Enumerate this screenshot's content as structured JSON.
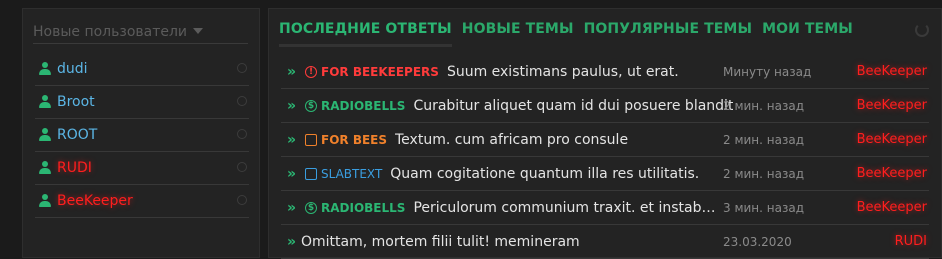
{
  "sidebar": {
    "select_label": "Новые пользователи",
    "users": [
      {
        "name": "dudi",
        "color": "#5bb6e6"
      },
      {
        "name": "Broot",
        "color": "#5bb6e6"
      },
      {
        "name": "ROOT",
        "color": "#5bb6e6"
      },
      {
        "name": "RUDI",
        "color": "#ff1e1e"
      },
      {
        "name": "BeeKeeper",
        "color": "#ff1e1e"
      }
    ]
  },
  "tabs": [
    "ПОСЛЕДНИЕ ОТВЕТЫ",
    "НОВЫЕ ТЕМЫ",
    "ПОПУЛЯРНЫЕ ТЕМЫ",
    "МОИ ТЕМЫ"
  ],
  "topics": [
    {
      "forum": "FOR BEEKEEPERS",
      "forum_icon": "alert-icon",
      "forum_color": "#ff3b3b",
      "title": "Suum existimans paulus, ut erat.",
      "time": "Минуту назад",
      "author": "BeeKeeper"
    },
    {
      "forum": "RADIOBELLS",
      "forum_icon": "dollar-icon",
      "forum_color": "#2bb673",
      "title": "Curabitur aliquet quam id dui posuere blandit",
      "time": "2 мин. назад",
      "author": "BeeKeeper"
    },
    {
      "forum": "FOR BEES",
      "forum_icon": "wallet-icon",
      "forum_color": "#f0812b",
      "title": "Textum. cum africam pro consule",
      "time": "2 мин. назад",
      "author": "BeeKeeper"
    },
    {
      "forum": "SLABTEXT",
      "forum_icon": "inbox-icon",
      "forum_color": "#3a9ee0",
      "title": "Quam cogitatione quantum illa res utilitatis.",
      "time": "2 мин. назад",
      "author": "BeeKeeper"
    },
    {
      "forum": "RADIOBELLS",
      "forum_icon": "dollar-icon",
      "forum_color": "#2bb673",
      "title": "Periculorum communium traxit. et instabat ut...",
      "time": "3 мин. назад",
      "author": "BeeKeeper"
    },
    {
      "forum": "",
      "forum_icon": "",
      "forum_color": "",
      "title": "Omittam, mortem filii tulit! memineram",
      "time": "23.03.2020",
      "author": "RUDI"
    }
  ],
  "colors": {
    "accent": "#2bb673",
    "admin": "#ff1e1e",
    "user": "#5bb6e6"
  }
}
